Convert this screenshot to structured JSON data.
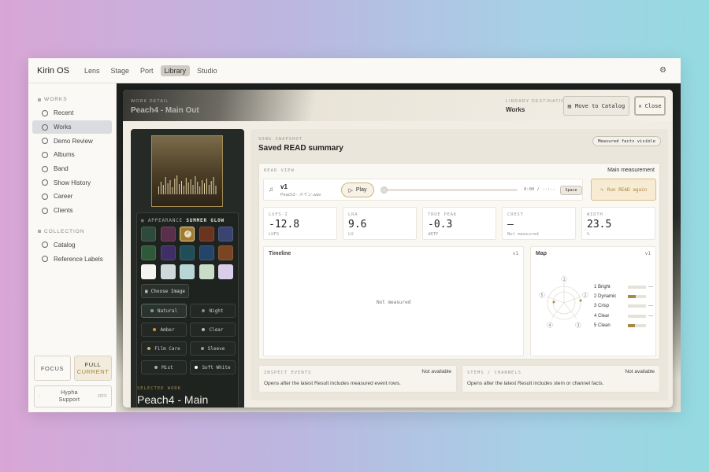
{
  "app": {
    "brand": "Kirin OS",
    "nav": [
      "Lens",
      "Stage",
      "Port",
      "Library",
      "Studio"
    ],
    "active_nav": "Library"
  },
  "sidebar": {
    "works_heading": "WORKS",
    "items": [
      {
        "label": "Recent",
        "icon": "clock-icon"
      },
      {
        "label": "Works",
        "icon": "list-icon",
        "active": true
      },
      {
        "label": "Demo Review",
        "icon": "headphones-icon"
      },
      {
        "label": "Albums",
        "icon": "album-icon"
      },
      {
        "label": "Band",
        "icon": "users-icon"
      },
      {
        "label": "Show History",
        "icon": "calendar-icon"
      },
      {
        "label": "Career",
        "icon": "chart-icon"
      },
      {
        "label": "Clients",
        "icon": "person-icon"
      }
    ],
    "collection_heading": "COLLECTION",
    "collection_items": [
      {
        "label": "Catalog",
        "icon": "grid-icon"
      },
      {
        "label": "Reference Labels",
        "icon": "tag-icon"
      }
    ],
    "focus_label": "FOCUS",
    "full_label": "FULL",
    "current_label": "CURRENT",
    "support_label": "Hypha Support",
    "support_state": "OFF"
  },
  "modal": {
    "header_label": "WORK DETAIL",
    "title": "Peach4 - Main Out",
    "destination_label": "LIBRARY DESTINATION",
    "destination_value": "Works",
    "move_button": "Move to Catalog",
    "close_button": "Close"
  },
  "appearance": {
    "heading": "APPEARANCE",
    "theme": "SUMMER GLOW",
    "choose_image": "Choose Image",
    "swatches": [
      "#2e4a3c",
      "#5a2f4a",
      "#a07a2e",
      "#6a3420",
      "#3a4470",
      "#2f5a3a",
      "#3f2f66",
      "#1f4e58",
      "#25446a",
      "#7a4522",
      "#f5f4f0",
      "#cfd8da",
      "#b9d6d6",
      "#c9dcc6",
      "#d9cde9"
    ],
    "selected_swatch": 2,
    "modes": [
      {
        "label": "Natural",
        "color": "#7aa38a",
        "active": true
      },
      {
        "label": "Night",
        "color": "#888"
      },
      {
        "label": "Amber",
        "color": "#c79a3a"
      },
      {
        "label": "Clear",
        "color": "#bbb"
      },
      {
        "label": "Film Care",
        "color": "#c9b26a"
      },
      {
        "label": "Sleeve",
        "color": "#999"
      },
      {
        "label": "Mist",
        "color": "#aaa"
      },
      {
        "label": "Soft White",
        "color": "#fff"
      }
    ],
    "selected_work_label": "SELECTED WORK",
    "selected_work_title": "Peach4 - Main"
  },
  "snapshot": {
    "label": "SONG SNAPSHOT",
    "title": "Saved READ summary",
    "badge": "Measured facts visible",
    "read_view_label": "READ VIEW",
    "read_view_right": "Main measurement",
    "version": "v1",
    "file": "Peach3 - メイン.wav",
    "play": "Play",
    "time": "0:00 / --:--",
    "shortcut": "Space",
    "run_button": "Run READ again",
    "metrics": [
      {
        "key": "LUFS-I",
        "value": "-12.8",
        "unit": "LUFS"
      },
      {
        "key": "LRA",
        "value": "9.6",
        "unit": "LU"
      },
      {
        "key": "TRUE PEAK",
        "value": "-0.3",
        "unit": "dBTP"
      },
      {
        "key": "CREST",
        "value": "—",
        "unit": "Not measured"
      },
      {
        "key": "WIDTH",
        "value": "23.5",
        "unit": "%"
      }
    ],
    "timeline_label": "Timeline",
    "timeline_version": "v1",
    "timeline_empty": "Not measured",
    "map_label": "Map",
    "map_version": "v1",
    "map_items": [
      {
        "label": "1 Bright",
        "value": "—",
        "fill": 0
      },
      {
        "label": "2 Dynamic",
        "value": "",
        "fill": 0.45
      },
      {
        "label": "3 Crisp",
        "value": "—",
        "fill": 0
      },
      {
        "label": "4 Clear",
        "value": "—",
        "fill": 0
      },
      {
        "label": "5 Clean",
        "value": "",
        "fill": 0.38
      }
    ],
    "radar_nums": [
      "1",
      "2",
      "3",
      "4",
      "5"
    ],
    "inspect_label": "INSPECT EVENTS",
    "inspect_status": "Not available",
    "inspect_desc": "Opens after the latest Result includes measured event rows.",
    "stems_label": "STEMS / CHANNELS",
    "stems_status": "Not available",
    "stems_desc": "Opens after the latest Result includes stem or channel facts."
  }
}
